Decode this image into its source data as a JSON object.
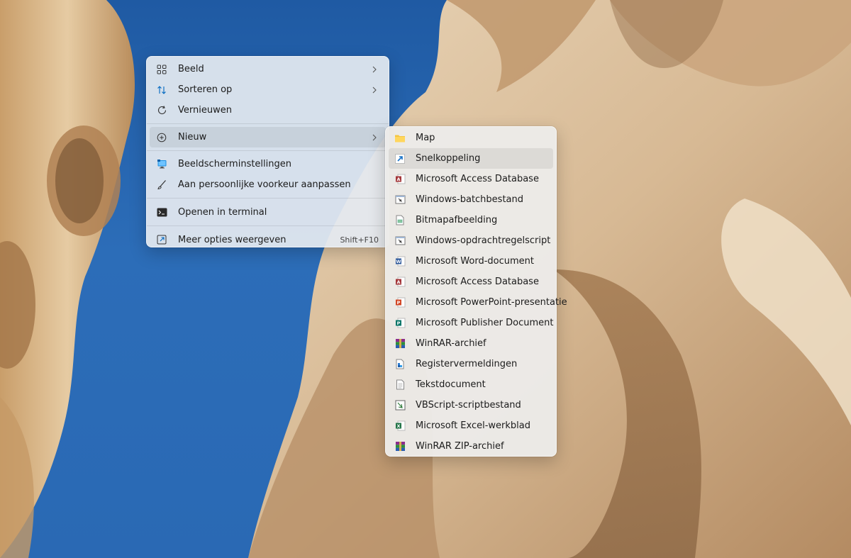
{
  "main_menu": {
    "items": [
      {
        "label": "Beeld",
        "icon": "grid-icon"
      },
      {
        "label": "Sorteren op",
        "icon": "sort-icon"
      },
      {
        "label": "Vernieuwen",
        "icon": "refresh-icon"
      },
      {
        "label": "Nieuw",
        "icon": "new-icon"
      },
      {
        "label": "Beeldscherminstellingen",
        "icon": "display-icon"
      },
      {
        "label": "Aan persoonlijke voorkeur aanpassen",
        "icon": "brush-icon"
      },
      {
        "label": "Openen in terminal",
        "icon": "terminal-icon"
      },
      {
        "label": "Meer opties weergeven",
        "icon": "more-options-icon",
        "shortcut": "Shift+F10"
      }
    ]
  },
  "sub_menu": {
    "items": [
      {
        "label": "Map",
        "icon": "folder-icon"
      },
      {
        "label": "Snelkoppeling",
        "icon": "shortcut-icon"
      },
      {
        "label": "Microsoft Access Database",
        "icon": "access-icon"
      },
      {
        "label": "Windows-batchbestand",
        "icon": "batch-file-icon"
      },
      {
        "label": "Bitmapafbeelding",
        "icon": "bitmap-icon"
      },
      {
        "label": "Windows-opdrachtregelscript",
        "icon": "cmd-script-icon"
      },
      {
        "label": "Microsoft Word-document",
        "icon": "word-icon"
      },
      {
        "label": "Microsoft Access Database",
        "icon": "access-icon"
      },
      {
        "label": "Microsoft PowerPoint-presentatie",
        "icon": "powerpoint-icon"
      },
      {
        "label": "Microsoft Publisher Document",
        "icon": "publisher-icon"
      },
      {
        "label": "WinRAR-archief",
        "icon": "winrar-icon"
      },
      {
        "label": "Registervermeldingen",
        "icon": "registry-icon"
      },
      {
        "label": "Tekstdocument",
        "icon": "text-document-icon"
      },
      {
        "label": "VBScript-scriptbestand",
        "icon": "vbscript-icon"
      },
      {
        "label": "Microsoft Excel-werkblad",
        "icon": "excel-icon"
      },
      {
        "label": "WinRAR ZIP-archief",
        "icon": "winrar-zip-icon"
      }
    ]
  },
  "colors": {
    "sky": "#2a66ae",
    "stone": "#d9b98f",
    "accent": "#0067c0",
    "word": "#2b579a",
    "excel": "#217346",
    "powerpoint": "#d24726",
    "access": "#a4373a",
    "publisher": "#077568"
  }
}
